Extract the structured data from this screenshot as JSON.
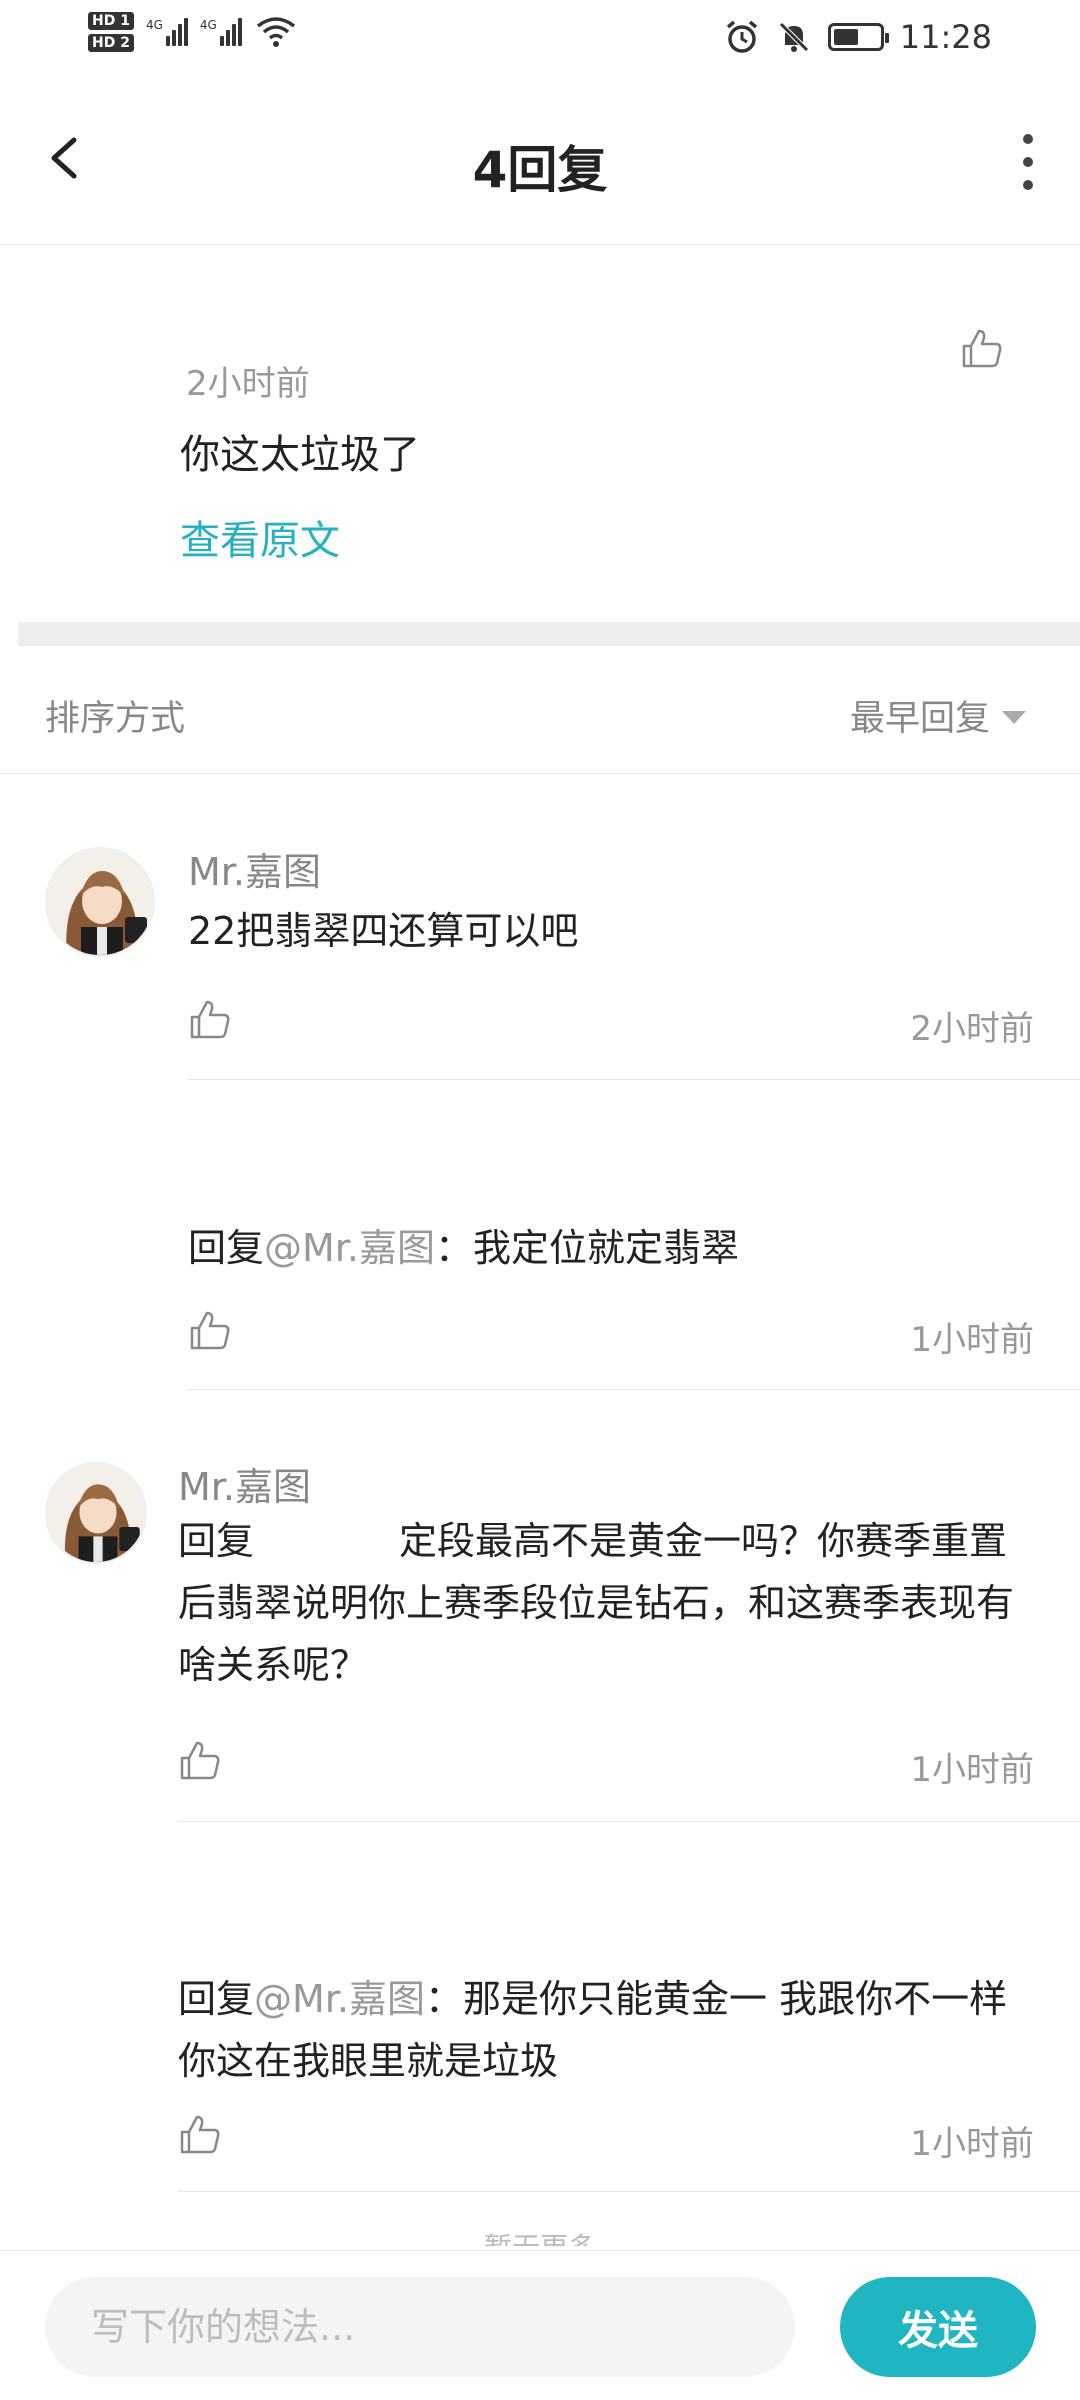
{
  "status_bar": {
    "sim1": "HD 1",
    "sim2": "HD 2",
    "network1": "4G",
    "network2": "4G",
    "time": "11:28",
    "battery_level": 0.55,
    "icons": [
      "alarm-icon",
      "mute-icon",
      "wifi-icon",
      "battery-icon"
    ]
  },
  "header": {
    "title": "4回复"
  },
  "original_comment": {
    "time": "2小时前",
    "text": "你这太垃圾了",
    "view_original": "查看原文"
  },
  "sort": {
    "label": "排序方式",
    "value": "最早回复"
  },
  "replies": [
    {
      "user": "Mr.嘉图",
      "text": "22把翡翠四还算可以吧",
      "time": "2小时前"
    },
    {
      "prefix": "回复",
      "mention": "@Mr.嘉图",
      "colon": "：",
      "text": "我定位就定翡翠",
      "time": "1小时前"
    },
    {
      "user": "Mr.嘉图",
      "text": "回复            定段最高不是黄金一吗？你赛季重置后翡翠说明你上赛季段位是钻石，和这赛季表现有啥关系呢？",
      "time": "1小时前"
    },
    {
      "prefix": "回复",
      "mention": "@Mr.嘉图",
      "colon": "：",
      "text": "那是你只能黄金一 我跟你不一样 你这在我眼里就是垃圾",
      "time": "1小时前"
    }
  ],
  "more_hint": "暂无更多",
  "input": {
    "placeholder": "写下你的想法..."
  },
  "send_label": "发送",
  "colors": {
    "accent": "#1fb5c1",
    "link": "#26b1c0"
  }
}
